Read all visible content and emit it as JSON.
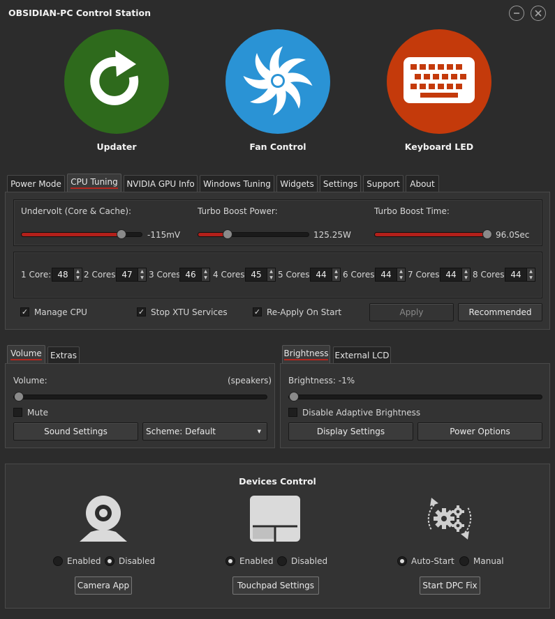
{
  "app": {
    "title": "OBSIDIAN-PC Control Station"
  },
  "window_buttons": {
    "minimize_icon": "minimize-icon",
    "close_icon": "close-icon"
  },
  "launchers": [
    {
      "label": "Updater",
      "color": "#2e6a1c",
      "icon": "refresh-arrow-icon"
    },
    {
      "label": "Fan Control",
      "color": "#2a93d5",
      "icon": "fan-icon"
    },
    {
      "label": "Keyboard LED",
      "color": "#c43a0b",
      "icon": "keyboard-icon"
    }
  ],
  "main_tabs": [
    "Power Mode",
    "CPU Tuning",
    "NVIDIA GPU Info",
    "Windows Tuning",
    "Widgets",
    "Settings",
    "Support",
    "About"
  ],
  "main_active_tab": "CPU Tuning",
  "cpu": {
    "undervolt": {
      "label": "Undervolt (Core & Cache):",
      "value": "-115mV",
      "level": 0.82
    },
    "turbo_power": {
      "label": "Turbo Boost Power:",
      "value": "125.25W",
      "level": 0.25
    },
    "turbo_time": {
      "label": "Turbo Boost Time:",
      "value": "96.0Sec",
      "level": 1.0
    },
    "cores": [
      {
        "label": "1 Core:",
        "value": "48"
      },
      {
        "label": "2 Cores:",
        "value": "47"
      },
      {
        "label": "3 Cores",
        "value": "46"
      },
      {
        "label": "4 Cores:",
        "value": "45"
      },
      {
        "label": "5 Cores:",
        "value": "44"
      },
      {
        "label": "6 Cores:",
        "value": "44"
      },
      {
        "label": "7 Cores:",
        "value": "44"
      },
      {
        "label": "8 Cores:",
        "value": "44"
      }
    ],
    "checks": [
      {
        "label": "Manage CPU",
        "checked": true
      },
      {
        "label": "Stop XTU Services",
        "checked": true
      },
      {
        "label": "Re-Apply On Start",
        "checked": true
      }
    ],
    "apply_label": "Apply",
    "recommended_label": "Recommended"
  },
  "audio": {
    "tabs": [
      "Volume",
      "Extras"
    ],
    "active_tab": "Volume",
    "volume_label": "Volume:",
    "device": "(speakers)",
    "level": 0.0,
    "mute_label": "Mute",
    "sound_settings_label": "Sound Settings",
    "scheme_value": "Scheme: Default"
  },
  "display": {
    "tabs": [
      "Brightness",
      "External LCD"
    ],
    "active_tab": "Brightness",
    "brightness_label": "Brightness: -1%",
    "level": 0.0,
    "adaptive_label": "Disable Adaptive Brightness",
    "display_settings_label": "Display Settings",
    "power_options_label": "Power Options"
  },
  "devices": {
    "title": "Devices Control",
    "camera": {
      "enabled_label": "Enabled",
      "disabled_label": "Disabled",
      "selected": "Disabled",
      "button": "Camera App",
      "icon": "webcam-icon"
    },
    "touchpad": {
      "enabled_label": "Enabled",
      "disabled_label": "Disabled",
      "selected": "Enabled",
      "button": "Touchpad Settings",
      "icon": "touchpad-icon"
    },
    "dpc": {
      "auto_label": "Auto-Start",
      "manual_label": "Manual",
      "selected": "Auto-Start",
      "button": "Start DPC Fix",
      "icon": "gears-cycle-icon"
    }
  }
}
